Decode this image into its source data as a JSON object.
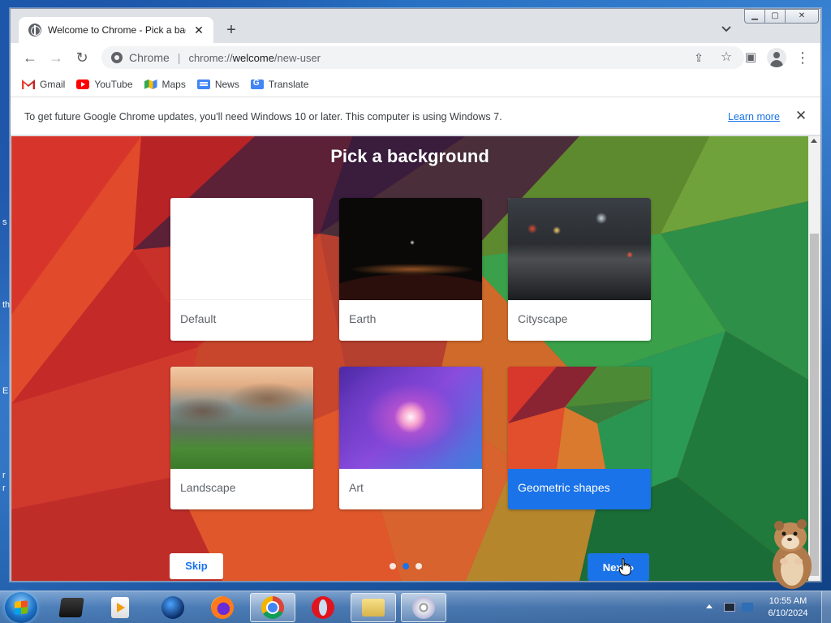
{
  "browser": {
    "tab": {
      "title": "Welcome to Chrome - Pick a bac",
      "close": "✕"
    },
    "new_tab": "+",
    "tab_search": "⌄",
    "window_controls": {
      "minimize": "▁",
      "maximize": "▢",
      "close": "✕"
    },
    "nav": {
      "back": "←",
      "forward": "→",
      "reload": "↻"
    },
    "omnibox": {
      "chip": "Chrome",
      "separator": "|",
      "url_prefix": "chrome://",
      "url_host": "welcome",
      "url_path": "/new-user"
    },
    "toolbar_icons": {
      "share": "⇪",
      "star": "☆",
      "sidepanel": "▣",
      "menu": "⋮"
    },
    "bookmarks": [
      {
        "label": "Gmail",
        "icon": "gmail-icon"
      },
      {
        "label": "YouTube",
        "icon": "youtube-icon"
      },
      {
        "label": "Maps",
        "icon": "maps-icon"
      },
      {
        "label": "News",
        "icon": "news-icon"
      },
      {
        "label": "Translate",
        "icon": "translate-icon"
      }
    ],
    "infobar": {
      "text": "To get future Google Chrome updates, you'll need Windows 10 or later. This computer is using Windows 7.",
      "link": "Learn more",
      "close": "✕"
    }
  },
  "page": {
    "title": "Pick a background",
    "backgrounds": [
      {
        "label": "Default",
        "selected": false
      },
      {
        "label": "Earth",
        "selected": false
      },
      {
        "label": "Cityscape",
        "selected": false
      },
      {
        "label": "Landscape",
        "selected": false
      },
      {
        "label": "Art",
        "selected": false
      },
      {
        "label": "Geometric shapes",
        "selected": true
      }
    ],
    "skip": "Skip",
    "next": "Next",
    "next_chevron": "›",
    "steps": {
      "count": 3,
      "active": 2
    }
  },
  "desktop": {
    "edge_chars": [
      "s",
      "th",
      "E",
      "r",
      "r"
    ]
  },
  "taskbar": {
    "apps": [
      "Media box",
      "Media player",
      "Globe",
      "Firefox",
      "Chrome",
      "Opera",
      "File explorer",
      "Disc burner"
    ],
    "active_app": "Chrome",
    "time": "10:55 AM",
    "date": "6/10/2024"
  },
  "colors": {
    "accent": "#1a73e8",
    "link": "#1a73e8",
    "selected_card": "#1a73e8"
  }
}
